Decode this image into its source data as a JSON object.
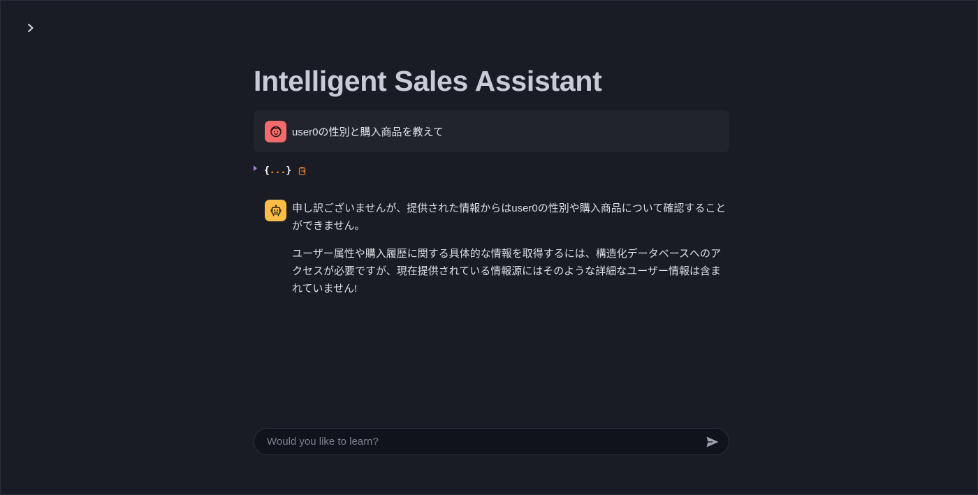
{
  "app": {
    "title": "Intelligent Sales Assistant"
  },
  "sidebar": {
    "toggle_icon": "chevron-right-icon"
  },
  "chat": {
    "messages": [
      {
        "role": "user",
        "avatar_icon": "user-face-icon",
        "avatar_color": "#f36b6b",
        "text": "user0の性別と購入商品を教えて"
      },
      {
        "role": "assistant",
        "avatar_icon": "robot-icon",
        "avatar_color": "#fbbd48",
        "paragraphs": [
          "申し訳ございませんが、提供された情報からはuser0の性別や購入商品について確認することができません。",
          "ユーザー属性や購入履歴に関する具体的な情報を取得するには、構造化データベースへのアクセスが必要ですが、現在提供されている情報源にはそのような詳細なユーザー情報は含まれていません!"
        ]
      }
    ],
    "json_viewer": {
      "open_brace": "{",
      "ellipsis": "...",
      "close_brace": "}",
      "collapsed": true,
      "copy_icon": "clipboard-icon"
    }
  },
  "input": {
    "placeholder": "Would you like to learn?",
    "value": "",
    "send_icon": "send-icon"
  },
  "colors": {
    "background": "#191c24",
    "message_background": "#21242d",
    "accent_purple": "#b07cf0",
    "accent_orange": "#f0a030"
  }
}
